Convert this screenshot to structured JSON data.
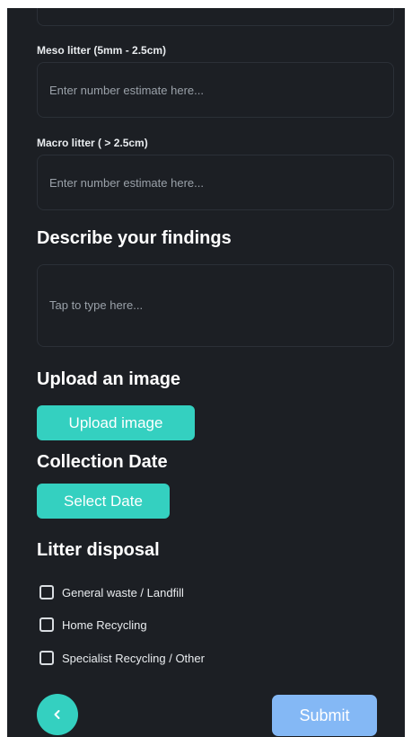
{
  "meso": {
    "label": "Meso litter (5mm - 2.5cm)",
    "placeholder": "Enter number estimate here..."
  },
  "macro": {
    "label": "Macro litter  ( > 2.5cm)",
    "placeholder": "Enter number estimate here..."
  },
  "findings": {
    "heading": "Describe your findings",
    "placeholder": "Tap to type here..."
  },
  "upload": {
    "heading": "Upload an image",
    "button_label": "Upload image"
  },
  "collection": {
    "heading": "Collection Date",
    "button_label": "Select Date"
  },
  "disposal": {
    "heading": "Litter disposal",
    "options": [
      {
        "label": "General waste / Landfill"
      },
      {
        "label": "Home Recycling"
      },
      {
        "label": "Specialist Recycling / Other"
      }
    ]
  },
  "footer": {
    "back_icon": "chevron-left-icon",
    "submit_label": "Submit"
  },
  "colors": {
    "background": "#1c1f24",
    "accent": "#34d0c0",
    "submit": "#84b8f5"
  }
}
